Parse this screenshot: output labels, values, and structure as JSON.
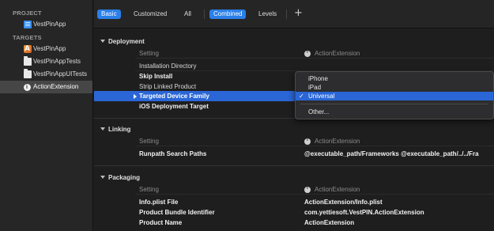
{
  "sidebar": {
    "project_header": "PROJECT",
    "project_item": "VestPinApp",
    "targets_header": "TARGETS",
    "targets": [
      {
        "label": "VestPinApp",
        "icon": "app-target-icon"
      },
      {
        "label": "VestPinAppTests",
        "icon": "folder-icon"
      },
      {
        "label": "VestPinAppUITests",
        "icon": "folder-icon"
      },
      {
        "label": "ActionExtension",
        "icon": "extension-icon"
      }
    ]
  },
  "toolbar": {
    "basic": "Basic",
    "customized": "Customized",
    "all": "All",
    "combined": "Combined",
    "levels": "Levels",
    "add": "+"
  },
  "sections": {
    "deployment": {
      "title": "Deployment",
      "hdr_setting": "Setting",
      "hdr_target": "ActionExtension",
      "rows": [
        {
          "key": "Installation Directory",
          "value": ""
        },
        {
          "key": "Skip Install",
          "value": ""
        },
        {
          "key": "Strip Linked Product",
          "value": ""
        },
        {
          "key": "Targeted Device Family",
          "value": ""
        },
        {
          "key": "iOS Deployment Target",
          "value": ""
        }
      ]
    },
    "linking": {
      "title": "Linking",
      "hdr_setting": "Setting",
      "hdr_target": "ActionExtension",
      "rows": [
        {
          "key": "Runpath Search Paths",
          "value": "@executable_path/Frameworks @executable_path/../../Fra"
        }
      ]
    },
    "packaging": {
      "title": "Packaging",
      "hdr_setting": "Setting",
      "hdr_target": "ActionExtension",
      "rows": [
        {
          "key": "Info.plist File",
          "value": "ActionExtension/Info.plist"
        },
        {
          "key": "Product Bundle Identifier",
          "value": "com.yettiesoft.VestPIN.ActionExtension"
        },
        {
          "key": "Product Name",
          "value": "ActionExtension"
        }
      ]
    }
  },
  "popup": {
    "options": [
      "iPhone",
      "iPad",
      "Universal"
    ],
    "selected": "Universal",
    "check": "✓",
    "other": "Other..."
  },
  "colors": {
    "accent": "#2a7fe8",
    "selection": "#2a66d6",
    "background": "#1e1e1e"
  }
}
